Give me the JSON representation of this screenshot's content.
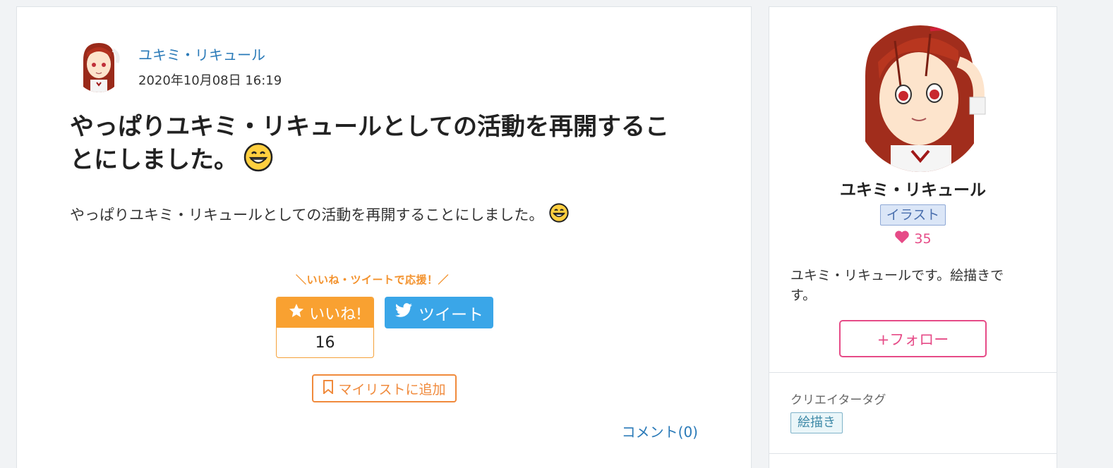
{
  "post": {
    "author_name": "ユキミ・リキュール",
    "date": "2020年10月08日 16:19",
    "title": "やっぱりユキミ・リキュールとしての活動を再開することにしました。",
    "title_emoji": "grinning-face-emoji",
    "body": "やっぱりユキミ・リキュールとしての活動を再開することにしました。",
    "cheer_text": "＼いいね・ツイートで応援！／",
    "like_label": "いいね!",
    "like_count": "16",
    "tweet_label": "ツイート",
    "mylist_label": "マイリストに追加",
    "comment_link": "コメント(0)"
  },
  "sidebar": {
    "creator_name": "ユキミ・リキュール",
    "genre": "イラスト",
    "fav_count": "35",
    "bio": "ユキミ・リキュールです。絵描きです。",
    "follow_label": "+フォロー",
    "tags_heading": "クリエイタータグ",
    "tags": [
      "絵描き"
    ]
  },
  "colors": {
    "link": "#2a7ab8",
    "like": "#f9a131",
    "twitter": "#3aa6e8",
    "mylist": "#f08a3c",
    "follow": "#e64b87",
    "heart": "#e64b87"
  }
}
